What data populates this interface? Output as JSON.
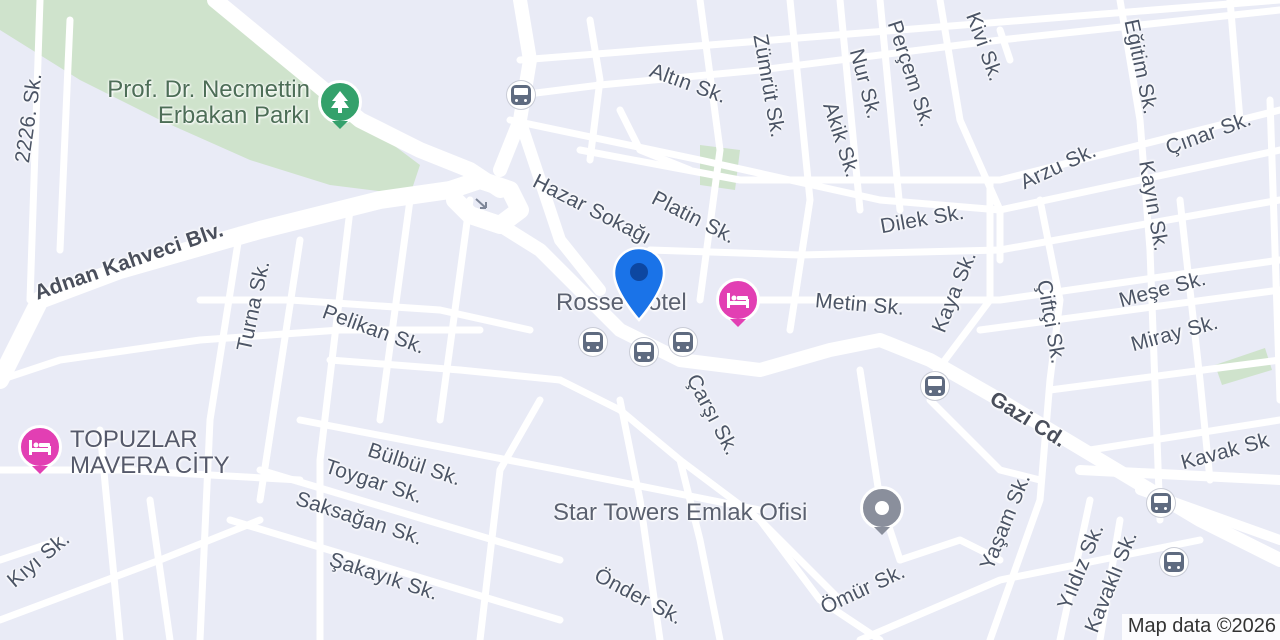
{
  "streets": {
    "adnan_kahveci": "Adnan Kahveci Blv.",
    "gazi": "Gazi Cd.",
    "hazar": "Hazar Sokağı",
    "altin": "Altın Sk.",
    "zumrut": "Zümrüt Sk.",
    "nur": "Nur Sk.",
    "percem": "Perçem Sk.",
    "kivi": "Kivi Sk.",
    "egitim": "Eğitim Sk.",
    "akik": "Akik Sk.",
    "cinar": "Çınar Sk.",
    "arzu": "Arzu Sk.",
    "kayin": "Kayın Sk.",
    "platin": "Platin Sk.",
    "dilek": "Dilek Sk.",
    "metin": "Metin Sk.",
    "kaya": "Kaya Sk.",
    "ciftci": "Çiftçi Sk.",
    "mese": "Meşe Sk.",
    "miray": "Miray Sk.",
    "sk2226": "2226. Sk.",
    "turna": "Turna Sk.",
    "pelikan": "Pelikan Sk.",
    "carsi": "Çarşı Sk.",
    "bulbul": "Bülbül Sk.",
    "toygar": "Toygar Sk.",
    "saksagan": "Saksağan Sk.",
    "sakayik": "Şakayık Sk.",
    "onder": "Önder Sk.",
    "omur": "Ömür Sk.",
    "yasam": "Yaşam Sk.",
    "yildiz": "Yıldız Sk.",
    "kavakli": "Kavaklı Sk.",
    "kavak": "Kavak Sk",
    "kiyi": "Kıyı Sk."
  },
  "pois": {
    "park_line1": "Prof. Dr. Necmettin",
    "park_line2": "Erbakan Parkı",
    "hotel": "Rosse Hotel",
    "topuzlar_line1": "TOPUZLAR",
    "topuzlar_line2": "MAVERA CİTY",
    "star_towers": "Star Towers Emlak Ofisi"
  },
  "icons": {
    "park": "tree-icon",
    "hotel": "bed-icon",
    "office": "generic-place-icon",
    "transit": "bus-stop-icon",
    "pin": "location-pin-icon"
  },
  "colors": {
    "background": "#e9ebf6",
    "park": "#cfe3cc",
    "park_marker": "#34a16b",
    "hotel_marker": "#e23fb3",
    "office_marker": "#8a8f9c",
    "pin": "#1a73e8",
    "road": "#ffffff"
  },
  "attribution": "Map data ©2026"
}
